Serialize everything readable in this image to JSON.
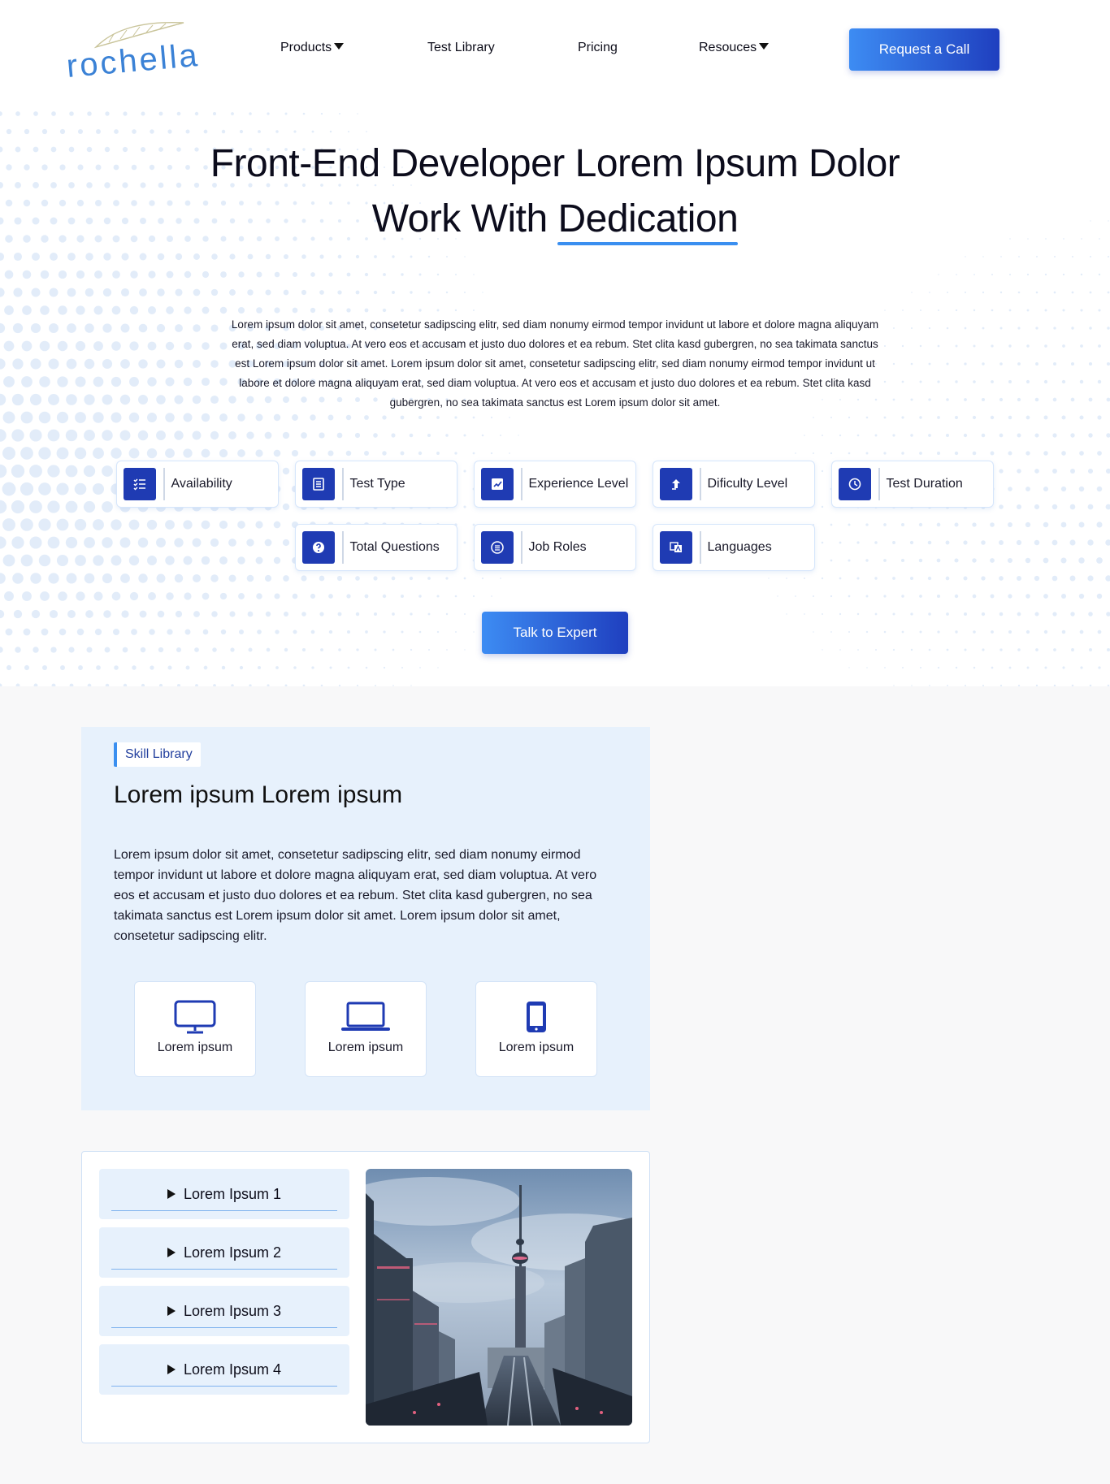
{
  "brand": {
    "logo_text": "rochella",
    "accent": "#3a8ff0",
    "primary_dark": "#1f3bb3"
  },
  "nav": {
    "items": [
      {
        "label": "Products",
        "has_dropdown": true
      },
      {
        "label": "Test Library",
        "has_dropdown": false
      },
      {
        "label": "Pricing",
        "has_dropdown": false
      },
      {
        "label": "Resouces",
        "has_dropdown": true
      }
    ],
    "cta": "Request a Call"
  },
  "hero": {
    "title_line1": "Front-End Developer Lorem Ipsum Dolor",
    "title_line2_prefix": "Work With ",
    "title_line2_highlight": "Dedication",
    "paragraph": "Lorem ipsum dolor sit amet, consetetur sadipscing elitr, sed diam nonumy eirmod tempor invidunt ut labore et dolore magna aliquyam erat, sed diam voluptua. At vero eos et accusam et justo duo dolores et ea rebum. Stet clita kasd gubergren, no sea takimata sanctus est Lorem ipsum dolor sit amet. Lorem ipsum dolor sit amet, consetetur sadipscing elitr, sed diam nonumy eirmod tempor invidunt ut labore et dolore magna aliquyam erat, sed diam voluptua. At vero eos et accusam et justo duo dolores et ea rebum. Stet clita kasd gubergren, no sea takimata sanctus est Lorem ipsum dolor sit amet.",
    "filters": [
      {
        "label": "Availability",
        "icon": "checklist-icon"
      },
      {
        "label": "Test Type",
        "icon": "document-icon"
      },
      {
        "label": "Experience Level",
        "icon": "chart-edit-icon"
      },
      {
        "label": "Dificulty Level",
        "icon": "arrow-up-icon"
      },
      {
        "label": "Test Duration",
        "icon": "clock-icon"
      },
      {
        "label": "Total Questions",
        "icon": "question-icon"
      },
      {
        "label": "Job Roles",
        "icon": "list-circle-icon"
      },
      {
        "label": "Languages",
        "icon": "translate-icon"
      }
    ],
    "cta": "Talk to Expert"
  },
  "skill": {
    "tag": "Skill Library",
    "title": "Lorem ipsum Lorem ipsum",
    "text": "Lorem ipsum dolor sit amet, consetetur sadipscing elitr, sed diam nonumy eirmod tempor invidunt ut labore et dolore magna aliquyam erat, sed diam voluptua. At vero eos et accusam et justo duo dolores et ea rebum. Stet clita kasd gubergren, no sea takimata sanctus est Lorem ipsum dolor sit amet. Lorem ipsum dolor sit amet, consetetur sadipscing elitr.",
    "devices": [
      {
        "label": "Lorem ipsum",
        "icon": "desktop-icon"
      },
      {
        "label": "Lorem ipsum",
        "icon": "laptop-icon"
      },
      {
        "label": "Lorem ipsum",
        "icon": "mobile-icon"
      }
    ]
  },
  "accordion": {
    "items": [
      "Lorem Ipsum 1",
      "Lorem Ipsum 2",
      "Lorem Ipsum 3",
      "Lorem Ipsum 4"
    ],
    "image": "city-tower-photo"
  }
}
